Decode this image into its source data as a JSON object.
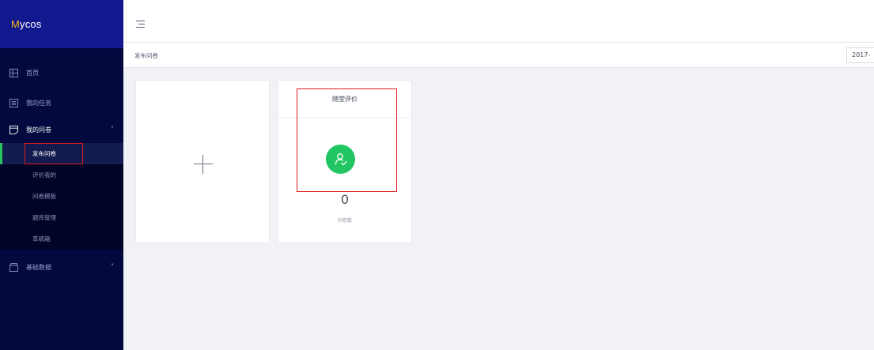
{
  "app": {
    "logo_initial": "M",
    "logo_rest": "ycos"
  },
  "sidebar": {
    "items": [
      {
        "label": "首页",
        "icon": "home-grid-icon"
      },
      {
        "label": "我的任务",
        "icon": "task-list-icon"
      },
      {
        "label": "我的问卷",
        "icon": "survey-icon",
        "expanded": true,
        "children": [
          {
            "label": "发布问卷",
            "active": true
          },
          {
            "label": "评价我的"
          },
          {
            "label": "问卷模板"
          },
          {
            "label": "题库管理"
          },
          {
            "label": "草稿箱"
          }
        ]
      },
      {
        "label": "基础数据",
        "icon": "folder-icon",
        "expanded": false
      }
    ],
    "caret_up": "˄",
    "caret_down": "˅"
  },
  "breadcrumb": {
    "current": "发布问卷"
  },
  "date_filter": {
    "value": "2017-"
  },
  "cards": {
    "add": {
      "icon": "plus-icon"
    },
    "evaluation": {
      "title": "随堂评价",
      "icon": "user-check-icon",
      "count": "0",
      "count_label": "问卷数"
    }
  },
  "colors": {
    "sidebar_bg": "#03093e",
    "logo_bar_bg": "#12198f",
    "accent_green": "#21c561",
    "highlight_red": "#e21b1b"
  }
}
